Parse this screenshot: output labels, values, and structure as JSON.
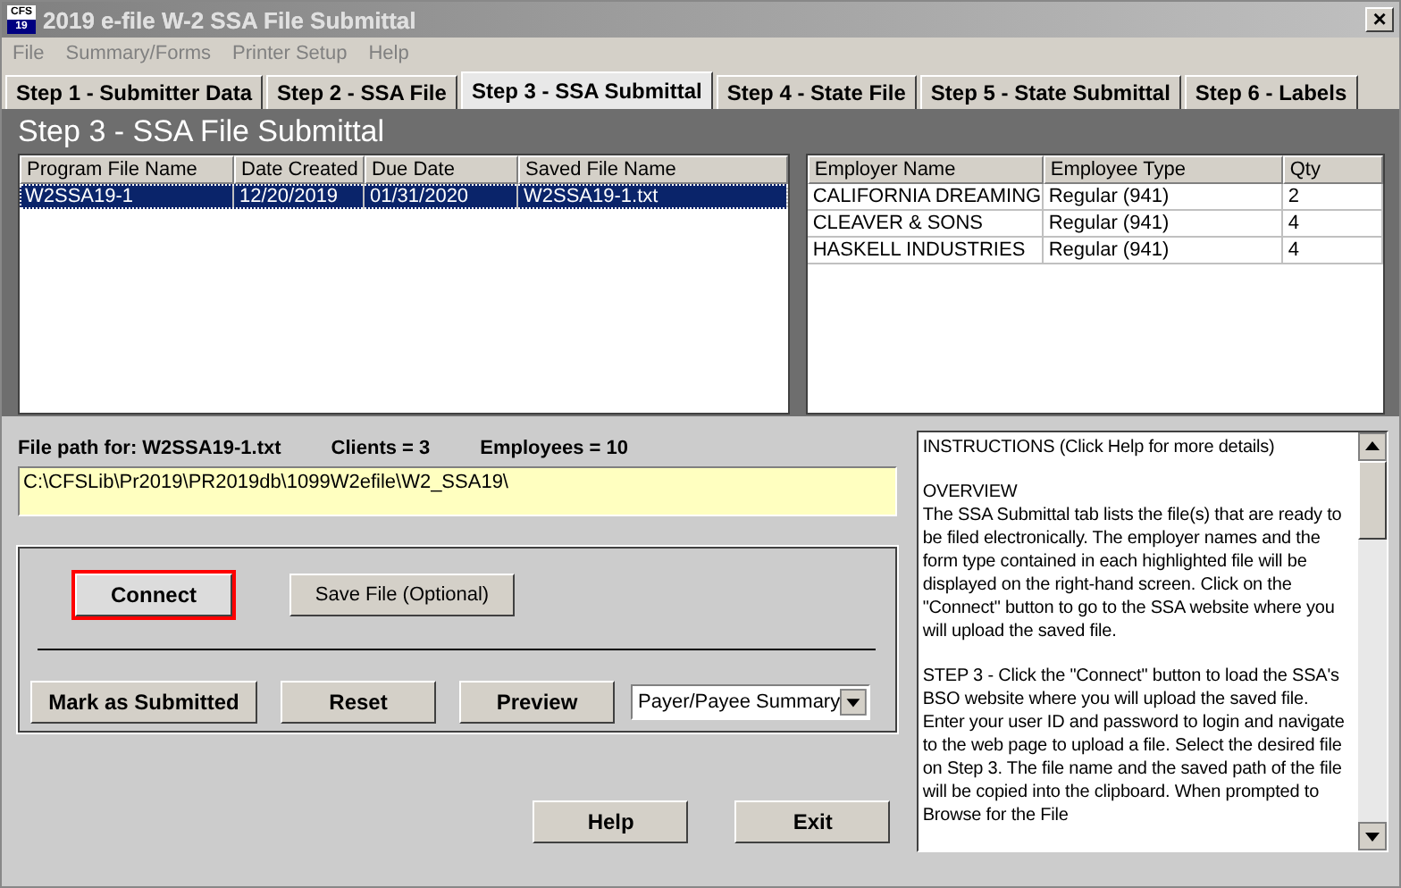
{
  "window": {
    "title": "2019 e-file W-2 SSA File Submittal",
    "icon_text": [
      "CFS",
      "19"
    ],
    "close": "×"
  },
  "menu": [
    "File",
    "Summary/Forms",
    "Printer Setup",
    "Help"
  ],
  "tabs": [
    {
      "label": "Step 1 - Submitter Data",
      "selected": false
    },
    {
      "label": "Step 2 - SSA File",
      "selected": false
    },
    {
      "label": "Step 3 - SSA Submittal",
      "selected": true
    },
    {
      "label": "Step 4 - State File",
      "selected": false
    },
    {
      "label": "Step 5 - State Submittal",
      "selected": false
    },
    {
      "label": "Step 6 - Labels",
      "selected": false
    }
  ],
  "page_title": "Step 3 - SSA File Submittal",
  "files_table": {
    "columns": [
      "Program File Name",
      "Date Created",
      "Due Date",
      "Saved File Name"
    ],
    "rows": [
      {
        "cells": [
          "W2SSA19-1",
          "12/20/2019",
          "01/31/2020",
          "W2SSA19-1.txt"
        ],
        "selected": true
      }
    ]
  },
  "employers_table": {
    "columns": [
      "Employer Name",
      "Employee Type",
      "Qty"
    ],
    "rows": [
      {
        "cells": [
          "CALIFORNIA DREAMING",
          "Regular (941)",
          "2"
        ]
      },
      {
        "cells": [
          "CLEAVER & SONS",
          "Regular (941)",
          "4"
        ]
      },
      {
        "cells": [
          "HASKELL INDUSTRIES",
          "Regular (941)",
          "4"
        ]
      }
    ]
  },
  "file_info": {
    "path_label": "File path for: W2SSA19-1.txt",
    "clients": "Clients = 3",
    "employees": "Employees = 10"
  },
  "file_path": "C:\\CFSLib\\Pr2019\\PR2019db\\1099W2efile\\W2_SSA19\\",
  "actions_top": [
    {
      "label": "Connect",
      "highlighted": true
    },
    {
      "label": "Save File (Optional)",
      "highlighted": false
    }
  ],
  "actions_bottom": [
    "Mark as Submitted",
    "Reset",
    "Preview"
  ],
  "report_select": {
    "value": "Payer/Payee Summary"
  },
  "instructions": [
    "INSTRUCTIONS (Click Help for more details)",
    "OVERVIEW\nThe SSA Submittal tab lists the file(s) that are ready to be filed electronically. The employer names and the form type contained in each highlighted file will be displayed on the right-hand screen. Click on the \"Connect\" button to go to the SSA website where you will upload the saved file.",
    "STEP 3 - Click the \"Connect\" button to load the SSA's BSO website where you will upload the saved file.  Enter your user ID and password to login and navigate to the web page to upload a file.  Select the desired file on Step 3.  The file name and the saved path of the file will be copied into the clipboard.  When prompted to Browse for the File"
  ],
  "footer_buttons": [
    "Help",
    "Exit"
  ]
}
